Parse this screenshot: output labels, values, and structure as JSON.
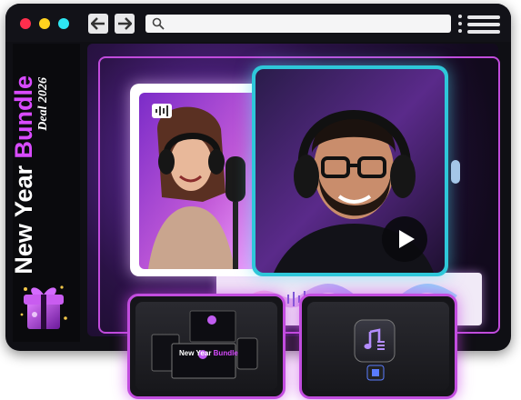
{
  "window": {
    "controls": [
      "close",
      "minimize",
      "maximize"
    ],
    "nav": {
      "back_icon": "arrow-left-icon",
      "forward_icon": "arrow-right-icon"
    },
    "address_bar": {
      "icon": "search-icon",
      "value": ""
    },
    "menu_icon": "hamburger-menu-icon"
  },
  "sidebar": {
    "brand_part1": "New Year ",
    "brand_part2": "Bundle",
    "brand_sub": "Deal 2026"
  },
  "thumbnails": {
    "left": {
      "title_part1": "New Year ",
      "title_part2": "Bundle"
    },
    "right": {
      "icon": "music-note-icon"
    }
  },
  "media": {
    "play_icon": "play-icon",
    "record_icon": "audio-wave-icon"
  },
  "colors": {
    "accent_purple": "#c24ddf",
    "accent_cyan": "#2ec7d9",
    "dot_red": "#ff2e4d",
    "dot_yellow": "#ffd21f",
    "dot_cyan": "#2ee6f2"
  }
}
